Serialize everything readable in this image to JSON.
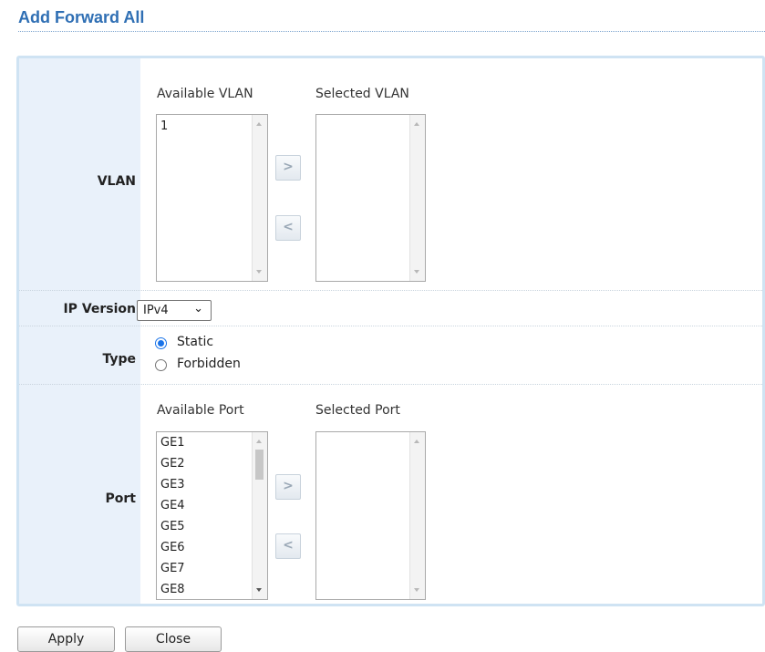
{
  "title": "Add Forward All",
  "vlan": {
    "label": "VLAN",
    "available_label": "Available VLAN",
    "selected_label": "Selected VLAN",
    "available_items": [
      "1"
    ],
    "selected_items": [],
    "add_glyph": ">",
    "remove_glyph": "<"
  },
  "ip_version": {
    "label": "IP Version",
    "selected": "IPv4",
    "chevron": "⌄"
  },
  "type": {
    "label": "Type",
    "options": [
      {
        "label": "Static",
        "checked": true
      },
      {
        "label": "Forbidden",
        "checked": false
      }
    ]
  },
  "port": {
    "label": "Port",
    "available_label": "Available Port",
    "selected_label": "Selected Port",
    "available_items": [
      "GE1",
      "GE2",
      "GE3",
      "GE4",
      "GE5",
      "GE6",
      "GE7",
      "GE8"
    ],
    "selected_items": [],
    "add_glyph": ">",
    "remove_glyph": "<"
  },
  "buttons": {
    "apply": "Apply",
    "close": "Close"
  },
  "colors": {
    "title": "#2f6fb4",
    "panel_border": "#cfe3f3",
    "label_column": "#e9f1fa",
    "radio_accent": "#1a73e8"
  }
}
